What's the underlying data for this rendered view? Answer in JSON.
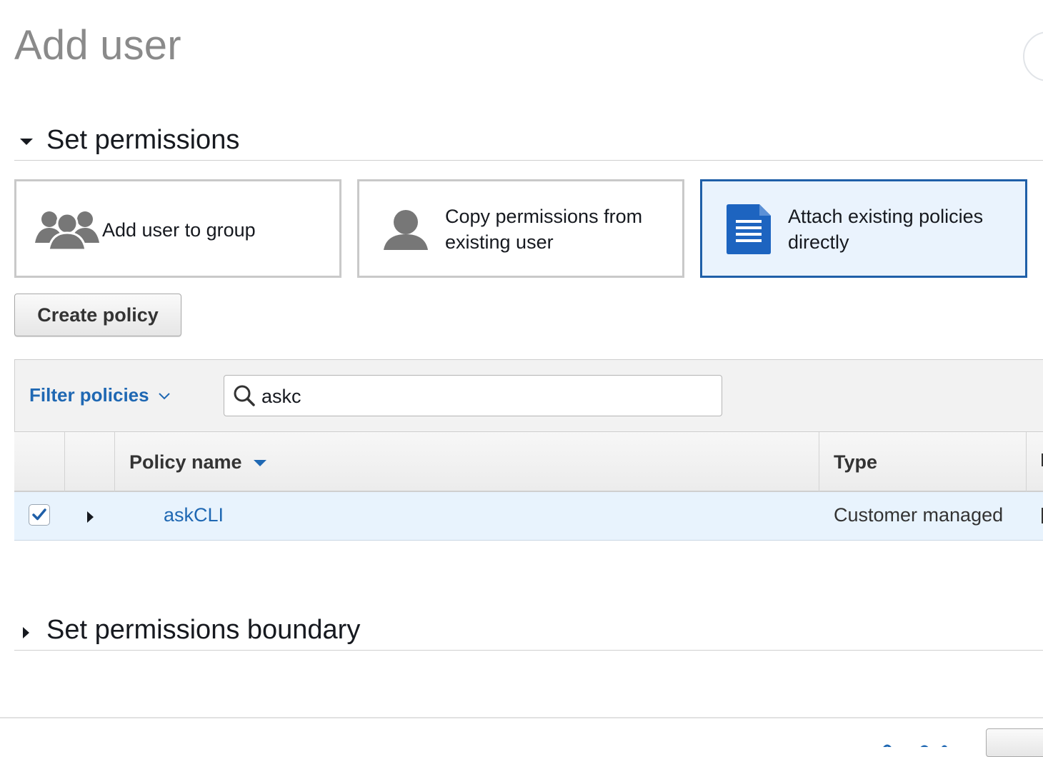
{
  "page": {
    "title": "Add user"
  },
  "set_permissions": {
    "header": "Set permissions",
    "options": [
      {
        "label": "Add user to group",
        "icon": "group-icon",
        "selected": false
      },
      {
        "label_line1": "Copy permissions from",
        "label_line2": "existing user",
        "icon": "user-icon",
        "selected": false
      },
      {
        "label_line1": "Attach existing policies",
        "label_line2": "directly",
        "icon": "document-icon",
        "selected": true
      }
    ],
    "create_policy_label": "Create policy",
    "filter": {
      "dropdown_label": "Filter policies",
      "search_value": "askc"
    },
    "table": {
      "columns": [
        "Policy name",
        "Type"
      ],
      "rows": [
        {
          "checked": true,
          "policy_name": "askCLI",
          "type": "Customer managed"
        }
      ]
    }
  },
  "boundary": {
    "header": "Set permissions boundary"
  },
  "colors": {
    "accent": "#1f68b3",
    "selected_border": "#1f5fa8",
    "selected_bg": "#eaf3fd",
    "row_selected_bg": "#e8f3fd"
  }
}
